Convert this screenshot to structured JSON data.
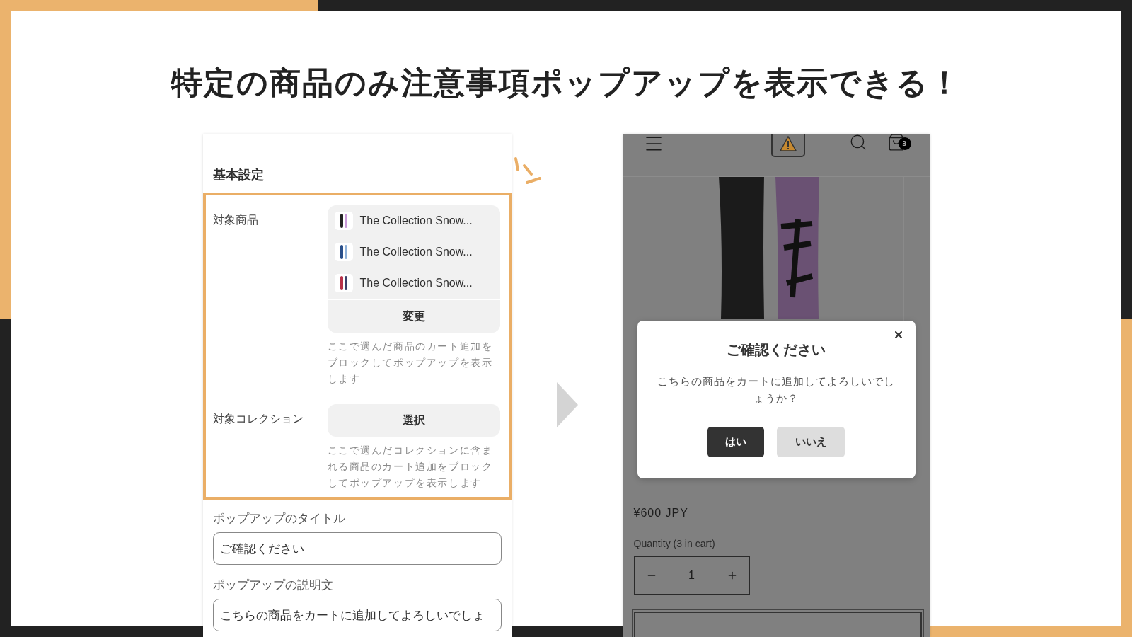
{
  "headline": "特定の商品のみ注意事項ポップアップを表示できる！",
  "settings_panel": {
    "section_title": "基本設定",
    "target_products": {
      "label": "対象商品",
      "items": [
        {
          "name": "The Collection Snow..."
        },
        {
          "name": "The Collection Snow..."
        },
        {
          "name": "The Collection Snow..."
        }
      ],
      "change_button": "変更",
      "help": "ここで選んだ商品のカート追加をブロックしてポップアップを表示します"
    },
    "target_collections": {
      "label": "対象コレクション",
      "select_button": "選択",
      "help": "ここで選んだコレクションに含まれる商品のカート追加をブロックしてポップアップを表示します"
    },
    "fields": [
      {
        "label": "ポップアップのタイトル",
        "value": "ご確認ください"
      },
      {
        "label": "ポップアップの説明文",
        "value": "こちらの商品をカートに追加してよろしいでしょ"
      }
    ]
  },
  "store_preview": {
    "cart_count": "3",
    "price": "¥600 JPY",
    "quantity_label": "Quantity (3 in cart)",
    "quantity": "1",
    "dialog": {
      "title": "ご確認ください",
      "message": "こちらの商品をカートに追加してよろしいでしょうか？",
      "confirm_button": "はい",
      "cancel_button": "いいえ"
    }
  }
}
